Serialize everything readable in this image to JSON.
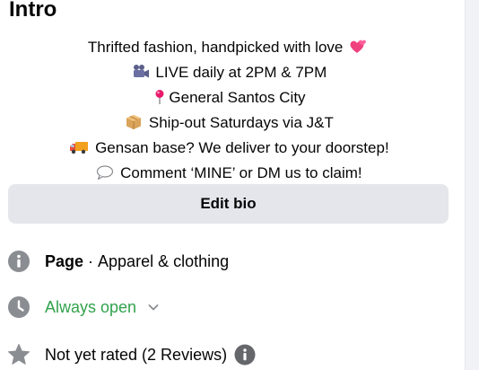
{
  "intro": {
    "title": "Intro",
    "bio_lines": [
      {
        "text": "Thrifted fashion, handpicked with love",
        "emoji": "hearts-icon",
        "emoji_position": "after"
      },
      {
        "text": "LIVE daily at 2PM & 7PM",
        "emoji": "video-camera-icon",
        "emoji_position": "before"
      },
      {
        "text": "General Santos City",
        "emoji": "pin-icon",
        "emoji_position": "before"
      },
      {
        "text": "Ship-out Saturdays via J&T",
        "emoji": "package-icon",
        "emoji_position": "before"
      },
      {
        "text": "Gensan base? We deliver to your doorstep!",
        "emoji": "delivery-truck-icon",
        "emoji_position": "before"
      },
      {
        "text": "Comment ‘MINE’ or DM us to claim!",
        "emoji": "speech-bubble-icon",
        "emoji_position": "before"
      }
    ],
    "edit_bio_label": "Edit bio",
    "page_row": {
      "bold": "Page",
      "separator": " · ",
      "category": "Apparel & clothing",
      "icon": "info-icon"
    },
    "hours_row": {
      "label": "Always open",
      "icon": "clock-icon",
      "chevron": "chevron-down-icon"
    },
    "rating_row": {
      "label": "Not yet rated (2 Reviews)",
      "icon": "star-icon",
      "info": "info-icon"
    },
    "colors": {
      "button_bg": "#e4e6eb",
      "icon_gray": "#65676b",
      "open_green": "#31a24c",
      "text": "#050505",
      "rail": "#f0f2f5"
    }
  }
}
